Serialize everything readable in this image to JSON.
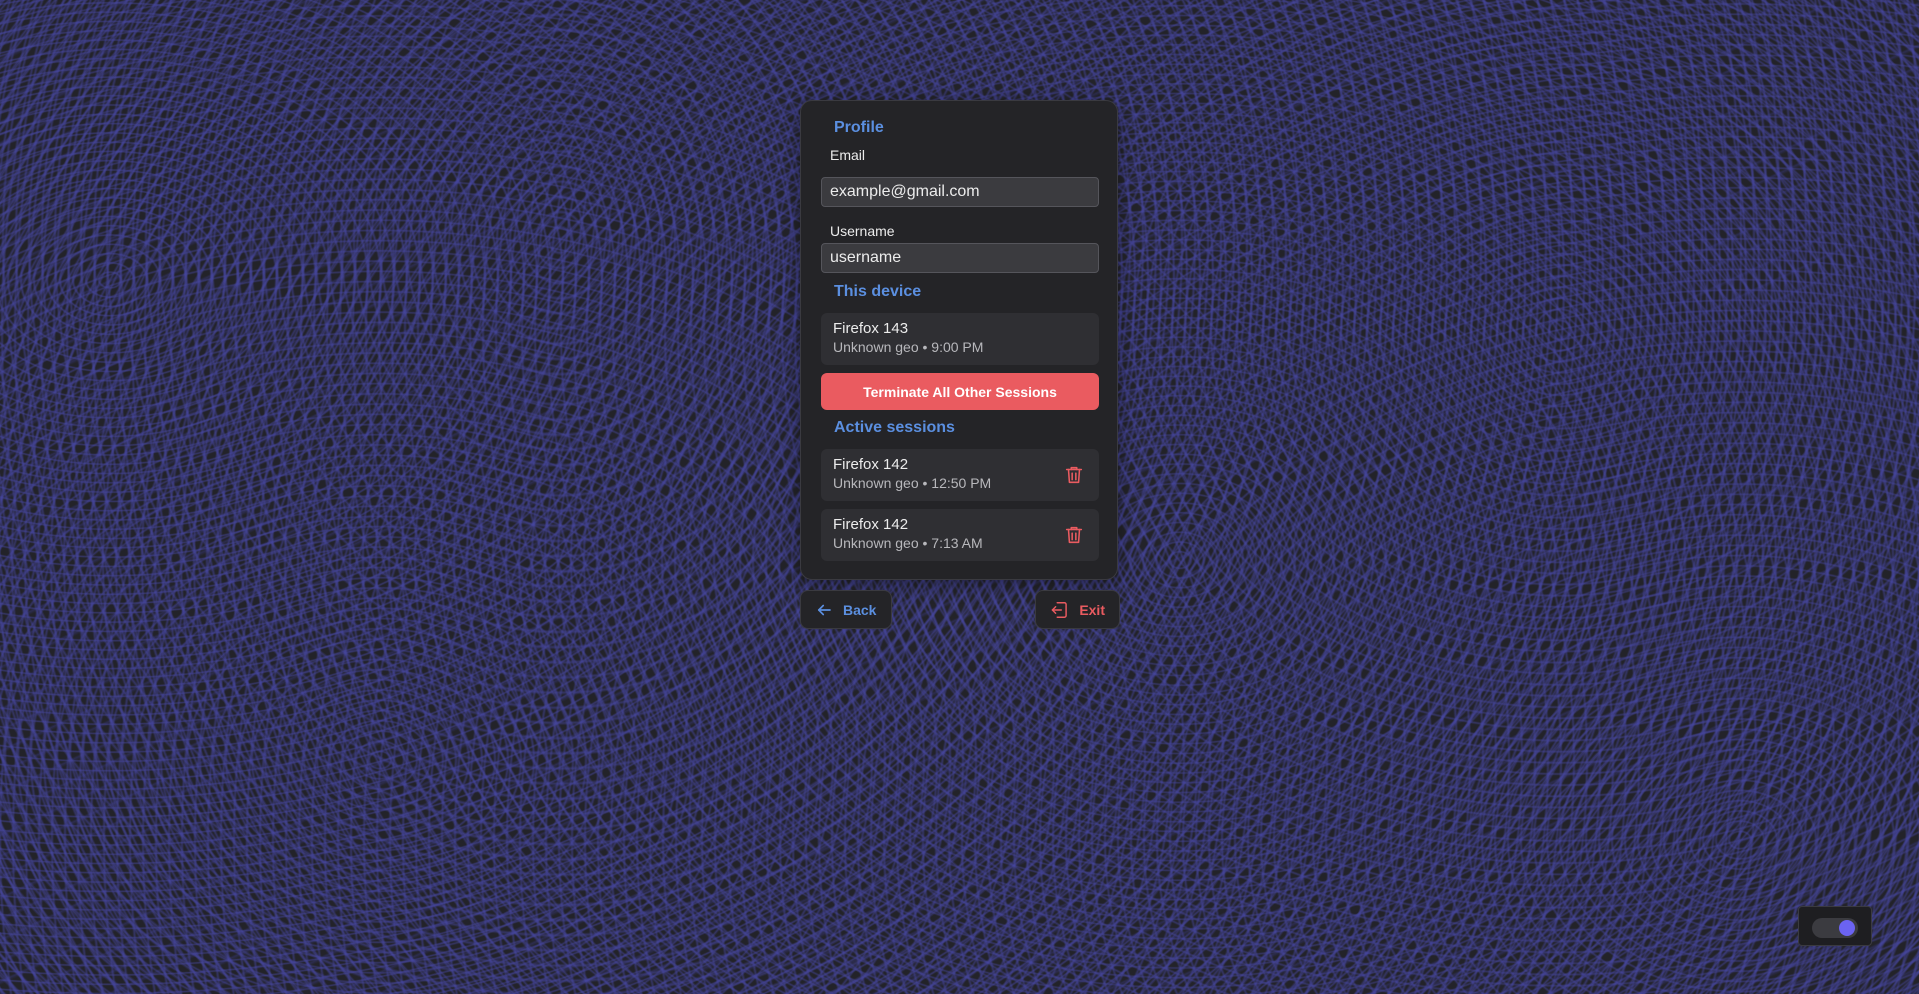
{
  "profile": {
    "title": "Profile",
    "email_label": "Email",
    "email_value": "example@gmail.com",
    "username_label": "Username",
    "username_value": "username"
  },
  "this_device": {
    "title": "This device",
    "name": "Firefox 143",
    "meta": "Unknown geo • 9:00 PM"
  },
  "terminate_label": "Terminate All Other Sessions",
  "active_sessions": {
    "title": "Active sessions",
    "items": [
      {
        "name": "Firefox 142",
        "meta": "Unknown geo • 12:50 PM",
        "delete_icon": "trash-icon"
      },
      {
        "name": "Firefox 142",
        "meta": "Unknown geo • 7:13 AM",
        "delete_icon": "trash-icon"
      }
    ]
  },
  "nav": {
    "back_label": "Back",
    "back_icon": "arrow-left-icon",
    "exit_label": "Exit",
    "exit_icon": "logout-icon"
  },
  "theme_toggle": {
    "state": "on",
    "knob_color": "#6b63f2"
  },
  "colors": {
    "accent_blue": "#5b8fe0",
    "danger": "#ea5b60",
    "card_bg": "#242427",
    "page_bg": "#232329"
  }
}
